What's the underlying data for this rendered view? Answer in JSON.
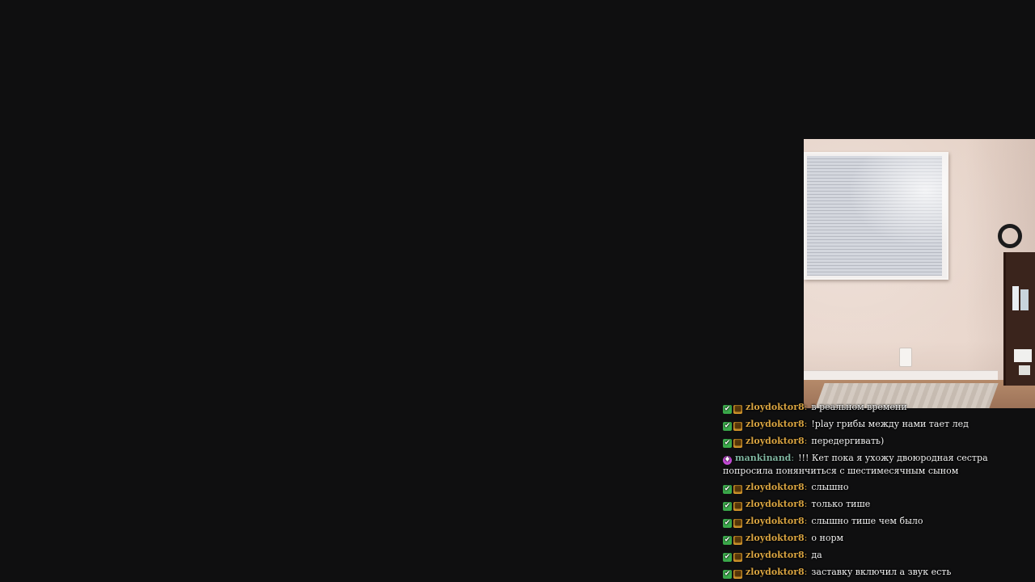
{
  "colors": {
    "background": "#0f0f10",
    "user_zloydoktor8": "#d9a441",
    "user_mankinand": "#7fb6a0",
    "message_text": "#f2f2f2"
  },
  "chat": {
    "messages": [
      {
        "badges": [
          "check-badge-icon",
          "gift-badge-icon"
        ],
        "user": "zloydoktor8",
        "text": "в реальном времени"
      },
      {
        "badges": [
          "check-badge-icon",
          "gift-badge-icon"
        ],
        "user": "zloydoktor8",
        "text": "!play грибы между нами тает лед"
      },
      {
        "badges": [
          "check-badge-icon",
          "gift-badge-icon"
        ],
        "user": "zloydoktor8",
        "text": "передергивать)"
      },
      {
        "badges": [
          "gem-badge-icon"
        ],
        "user": "mankinand",
        "text": "!!! Кет пока я ухожу двоюродная сестра попросила понянчиться с шестимесячным сыном"
      },
      {
        "badges": [
          "check-badge-icon",
          "gift-badge-icon"
        ],
        "user": "zloydoktor8",
        "text": "слышно"
      },
      {
        "badges": [
          "check-badge-icon",
          "gift-badge-icon"
        ],
        "user": "zloydoktor8",
        "text": "только тише"
      },
      {
        "badges": [
          "check-badge-icon",
          "gift-badge-icon"
        ],
        "user": "zloydoktor8",
        "text": "слышно тише чем было"
      },
      {
        "badges": [
          "check-badge-icon",
          "gift-badge-icon"
        ],
        "user": "zloydoktor8",
        "text": "о норм"
      },
      {
        "badges": [
          "check-badge-icon",
          "gift-badge-icon"
        ],
        "user": "zloydoktor8",
        "text": "да"
      },
      {
        "badges": [
          "check-badge-icon",
          "gift-badge-icon"
        ],
        "user": "zloydoktor8",
        "text": "заставку включил а звук есть"
      }
    ]
  }
}
